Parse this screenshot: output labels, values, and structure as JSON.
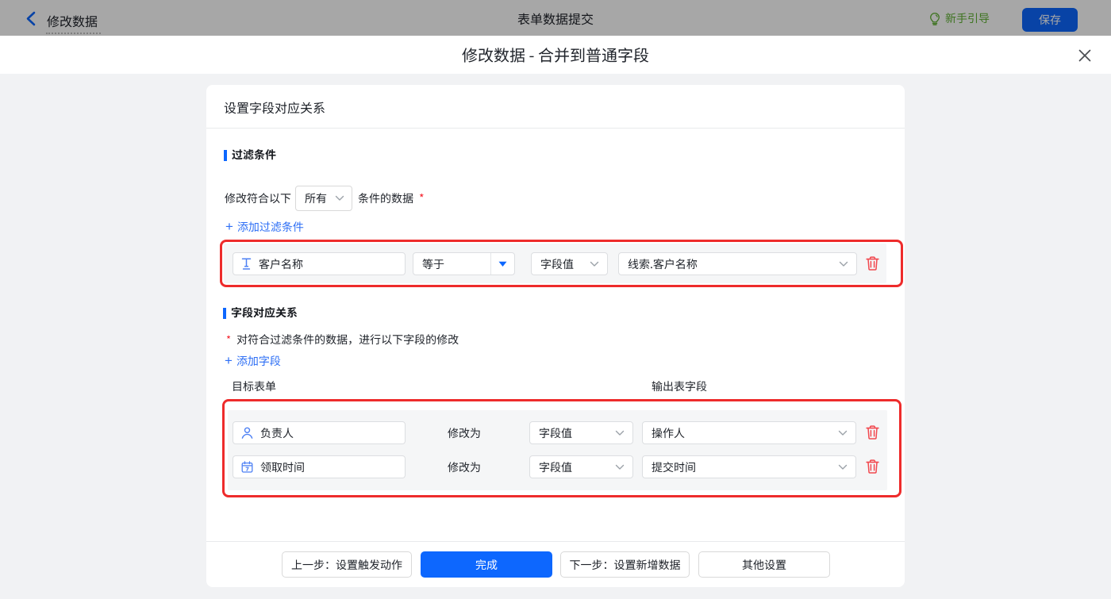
{
  "colors": {
    "primary_blue": "#0d67fe",
    "link_blue": "#2e6ff5",
    "field_icon_blue": "#4d80f4",
    "guide_green": "#67c23a",
    "highlight_red": "#ee2b2b",
    "trash_red": "#f2484e",
    "required_red": "#f5222d",
    "page_bg": "#f1f2f4",
    "panel_gray": "#f5f6f7"
  },
  "topbar": {
    "back_label": "修改数据",
    "center_title": "表单数据提交",
    "guide_label": "新手引导",
    "save_label": "保存"
  },
  "modal": {
    "title": "修改数据 - 合并到普通字段"
  },
  "card": {
    "title": "设置字段对应关系",
    "filter_section": {
      "heading": "过滤条件",
      "match_prefix": "修改符合以下",
      "match_mode": "所有",
      "match_suffix": "条件的数据",
      "required_mark": "*",
      "add_plus": "+",
      "add_label": "添加过滤条件",
      "row": {
        "field": "客户名称",
        "operator": "等于",
        "value_type": "字段值",
        "value": "线索.客户名称"
      }
    },
    "mapping_section": {
      "heading": "字段对应关系",
      "required_mark": "*",
      "description": "对符合过滤条件的数据，进行以下字段的修改",
      "add_plus": "+",
      "add_label": "添加字段",
      "col_left": "目标表单",
      "col_right": "输出表字段",
      "action_label": "修改为",
      "rows": [
        {
          "field": "负责人",
          "action": "修改为",
          "value_type": "字段值",
          "value": "操作人"
        },
        {
          "field": "领取时间",
          "action": "修改为",
          "value_type": "字段值",
          "value": "提交时间"
        }
      ]
    },
    "footer": {
      "prev": "上一步：设置触发动作",
      "done": "完成",
      "next": "下一步：设置新增数据",
      "other": "其他设置"
    }
  }
}
